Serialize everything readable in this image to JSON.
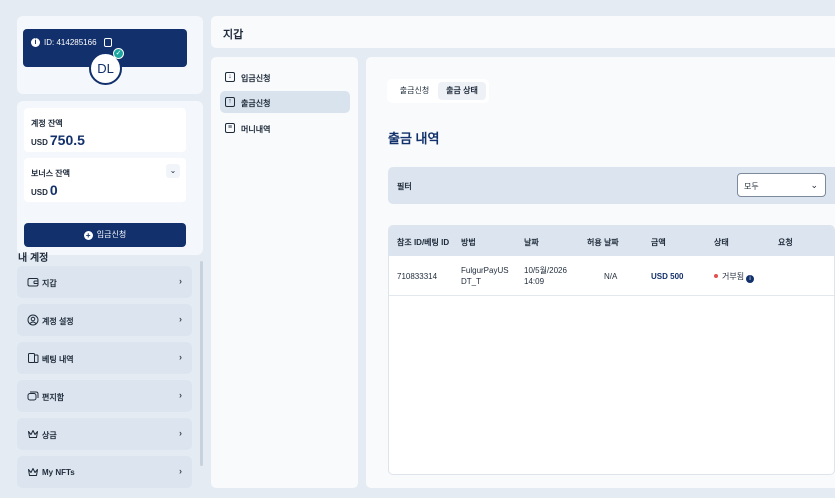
{
  "profile": {
    "id_label": "ID:",
    "id_value": "414285166",
    "initials": "DL"
  },
  "balances": {
    "account_label": "계정 잔액",
    "account_currency": "USD",
    "account_amount": "750.5",
    "bonus_label": "보너스 잔액",
    "bonus_currency": "USD",
    "bonus_amount": "0",
    "deposit_button": "입금신청"
  },
  "my_account": {
    "heading": "내 계정",
    "items": [
      {
        "label": "지갑",
        "icon": "wallet-icon"
      },
      {
        "label": "계정 설정",
        "icon": "user-circle-icon"
      },
      {
        "label": "베팅 내역",
        "icon": "betting-slip-icon"
      },
      {
        "label": "편지함",
        "icon": "messages-icon"
      },
      {
        "label": "상금",
        "icon": "crown-icon"
      },
      {
        "label": "My NFTs",
        "icon": "crown-icon"
      }
    ]
  },
  "topbar": {
    "title": "지갑"
  },
  "wallet_nav": {
    "items": [
      {
        "label": "입금신청",
        "icon": "download-icon",
        "active": false
      },
      {
        "label": "출금신청",
        "icon": "upload-icon",
        "active": true
      },
      {
        "label": "머니내역",
        "icon": "document-icon",
        "active": false
      }
    ]
  },
  "main": {
    "tabs": [
      {
        "label": "출금신청",
        "active": false
      },
      {
        "label": "출금 상태",
        "active": true
      }
    ],
    "section_title": "출금 내역",
    "filter": {
      "label": "필터",
      "selected": "모두"
    },
    "table": {
      "columns": [
        "참조 ID/베팅 ID",
        "방법",
        "날짜",
        "허용 날짜",
        "금액",
        "상태",
        "요청"
      ],
      "rows": [
        {
          "ref_id": "710833314",
          "method_line1": "FulgurPayUS",
          "method_line2": "DT_T",
          "date_line1": "10/5월/2026",
          "date_line2": "14:09",
          "allowed_date": "N/A",
          "amount": "USD 500",
          "status": "거부됨",
          "request": ""
        }
      ]
    }
  },
  "colors": {
    "brand_navy": "#12306b",
    "status_rejected": "#e35050",
    "verified": "#1ca8a0"
  }
}
